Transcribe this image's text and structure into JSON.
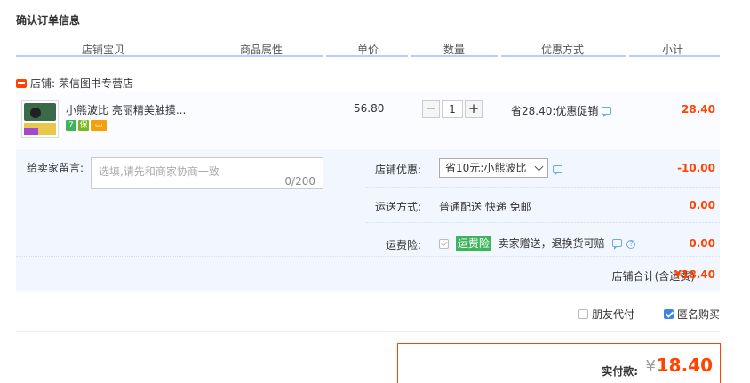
{
  "page_title": "确认订单信息",
  "columns": [
    "店铺宝贝",
    "商品属性",
    "单价",
    "数量",
    "优惠方式",
    "小计"
  ],
  "shop": {
    "label": "店铺:",
    "name": "荣信图书专营店"
  },
  "item": {
    "name": "小熊波比 亮丽精美触摸...",
    "price": "56.80",
    "quantity": "1",
    "decrement": "−",
    "increment": "+",
    "discount": "省28.40:优惠促销",
    "subtotal": "28.40",
    "badges": [
      "7",
      "保",
      "▭"
    ]
  },
  "note": {
    "label": "给卖家留言:",
    "placeholder": "选填,请先和商家协商一致",
    "count": "0/200"
  },
  "shop_coupon": {
    "label": "店铺优惠:",
    "selected": "省10元:小熊波比",
    "value": "-10.00"
  },
  "shipping": {
    "label": "运送方式:",
    "text": "普通配送 快递 免邮",
    "value": "0.00"
  },
  "insurance": {
    "label": "运费险:",
    "tag": "运费险",
    "text": "卖家赠送，退换货可赔",
    "value": "0.00"
  },
  "shop_total": {
    "label": "店铺合计(含运费)",
    "value": "¥18.40"
  },
  "options": {
    "friend_pay": "朋友代付",
    "anonymous": "匿名购买"
  },
  "payment": {
    "label": "实付款:",
    "currency": "¥",
    "value": "18.40"
  },
  "colors": {
    "accent": "#ff4400",
    "blue_line": "#b2d1ff",
    "detail_bg": "#f2f7ff"
  }
}
